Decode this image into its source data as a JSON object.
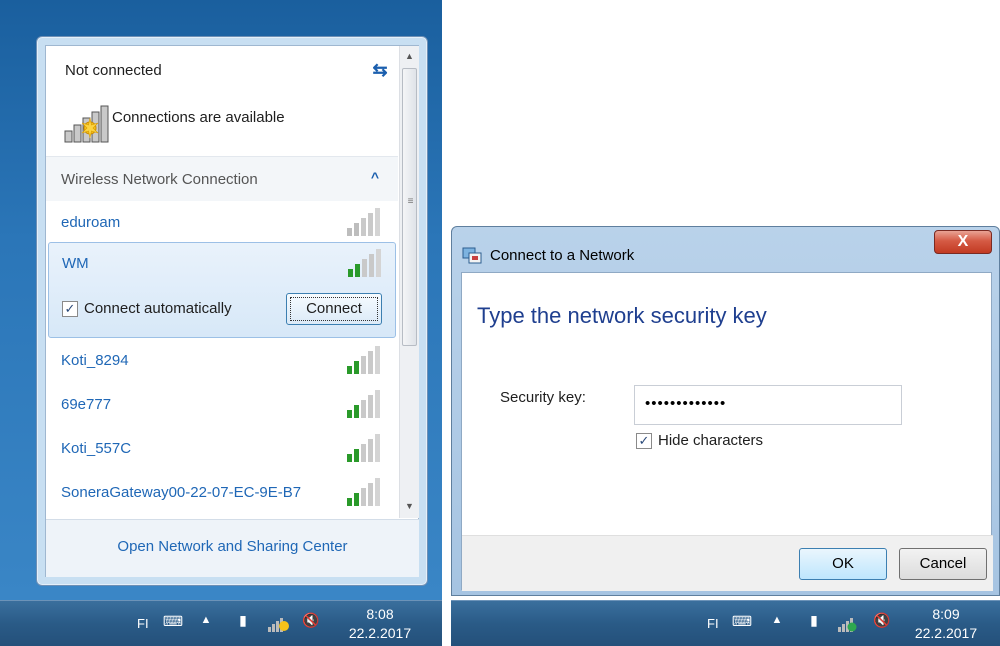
{
  "left_panel": {
    "status": "Not connected",
    "availability": "Connections are available",
    "section_label": "Wireless Network Connection",
    "networks": [
      {
        "name": "eduroam",
        "bars": 0
      },
      {
        "name": "WM",
        "bars": 2
      },
      {
        "name": "Koti_8294",
        "bars": 2
      },
      {
        "name": "69e777",
        "bars": 2
      },
      {
        "name": "Koti_557C",
        "bars": 2
      },
      {
        "name": "SoneraGateway00-22-07-EC-9E-B7",
        "bars": 2
      }
    ],
    "selected": {
      "connect_automatically_label": "Connect automatically",
      "connect_automatically_checked": true,
      "connect_button": "Connect"
    },
    "footer_link": "Open Network and Sharing Center"
  },
  "taskbar_left": {
    "language": "FI",
    "time": "8:08",
    "date": "22.2.2017"
  },
  "dialog": {
    "title": "Connect to a Network",
    "close_label": "X",
    "heading": "Type the network security key",
    "security_key_label": "Security key:",
    "security_key_value": "•••••••••••••",
    "hide_characters_label": "Hide characters",
    "hide_characters_checked": true,
    "ok": "OK",
    "cancel": "Cancel"
  },
  "taskbar_right": {
    "language": "FI",
    "time": "8:09",
    "date": "22.2.2017"
  },
  "colors": {
    "link": "#1f67b6",
    "heading": "#1f3f8f",
    "signal_green": "#2a9a2a",
    "signal_gray": "#b5b5b5"
  }
}
